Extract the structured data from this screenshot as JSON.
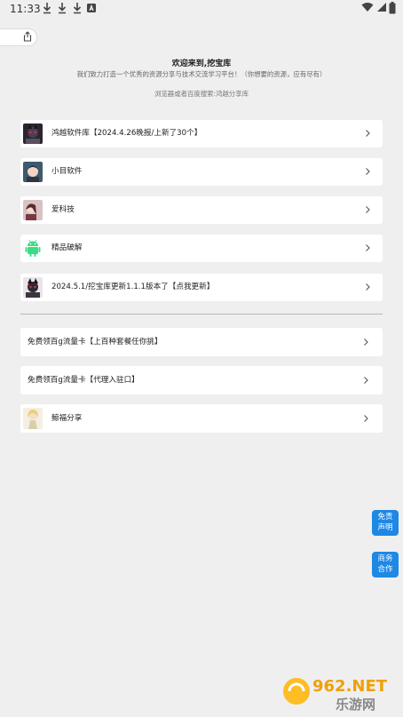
{
  "status_bar": {
    "time": "11:33"
  },
  "header": {
    "title": "欢迎来到,挖宝库",
    "subtitle": "我们致力打造一个优秀的资源分享与技术交流学习平台！（你想要的资源，应有尽有）",
    "hint": "浏览器或者百度搜索:鸿越分享库"
  },
  "cards_top": [
    {
      "label": "鸿越软件库【2024.4.26晚报/上新了30个】",
      "icon": "avatar-dark-icon"
    },
    {
      "label": "小目软件",
      "icon": "avatar-anime-icon"
    },
    {
      "label": "爱科技",
      "icon": "avatar-girl-icon"
    },
    {
      "label": "精品破解",
      "icon": "android-icon"
    },
    {
      "label": "2024.5.1/挖宝库更新1.1.1版本了【点我更新】",
      "icon": "avatar-dark-icon"
    }
  ],
  "cards_bottom": [
    {
      "label": "免费领百g流量卡【上百种套餐任你挑】"
    },
    {
      "label": "免费领百g流量卡【代理入驻口】"
    },
    {
      "label": "鲸福分享",
      "icon": "avatar-character-icon"
    }
  ],
  "side_buttons": {
    "disclaimer": "免责\n声明",
    "disclaimer_l1": "免责",
    "disclaimer_l2": "声明",
    "business_l1": "商务",
    "business_l2": "合作"
  },
  "watermark": {
    "top": "962.NET",
    "bottom": "乐游网"
  },
  "colors": {
    "accent": "#1e88e5",
    "background": "#efefef",
    "card": "#ffffff"
  }
}
